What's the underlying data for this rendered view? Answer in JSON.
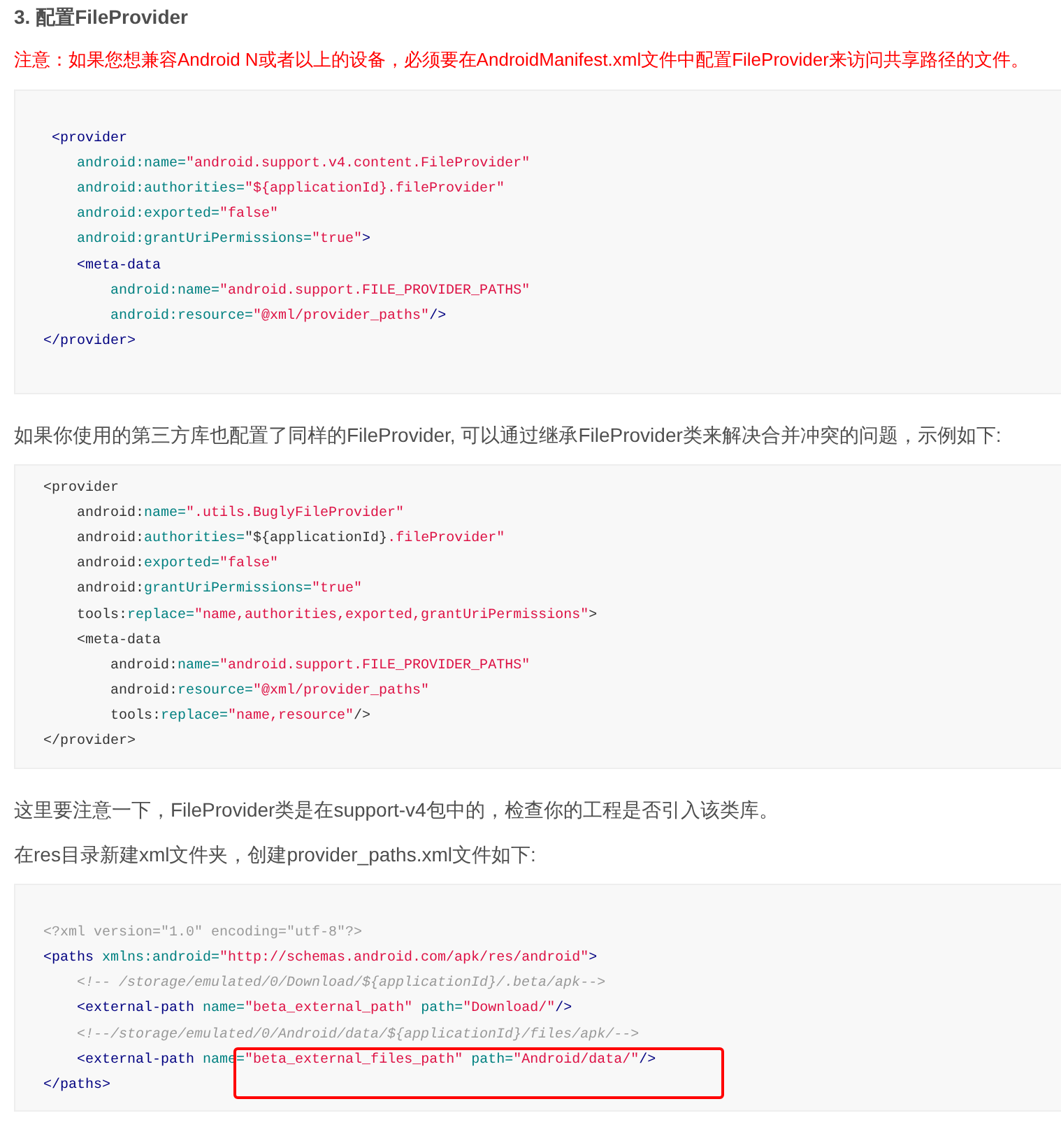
{
  "heading": "3. 配置FileProvider",
  "blocks": [
    {
      "kind": "note",
      "text": "注意：如果您想兼容Android N或者以上的设备，必须要在AndroidManifest.xml文件中配置FileProvider来访问共享路径的文件。"
    },
    {
      "kind": "code",
      "blank_before": true,
      "blank_after": true,
      "lines": [
        {
          "tokens": [
            {
              "kind": "tag",
              "text": " <provider"
            }
          ]
        },
        {
          "tokens": [
            {
              "kind": "attr",
              "text": "    android:name="
            },
            {
              "kind": "str",
              "text": "\"android.support.v4.content.FileProvider\""
            }
          ]
        },
        {
          "tokens": [
            {
              "kind": "attr",
              "text": "    android:authorities="
            },
            {
              "kind": "str",
              "text": "\"${applicationId}.fileProvider\""
            }
          ]
        },
        {
          "tokens": [
            {
              "kind": "attr",
              "text": "    android:exported="
            },
            {
              "kind": "str",
              "text": "\"false\""
            }
          ]
        },
        {
          "tokens": [
            {
              "kind": "attr",
              "text": "    android:grantUriPermissions="
            },
            {
              "kind": "str",
              "text": "\"true\""
            },
            {
              "kind": "tag",
              "text": ">"
            }
          ]
        },
        {
          "tokens": [
            {
              "kind": "tag",
              "text": "    <meta-data"
            }
          ]
        },
        {
          "tokens": [
            {
              "kind": "attr",
              "text": "        android:name="
            },
            {
              "kind": "str",
              "text": "\"android.support.FILE_PROVIDER_PATHS\""
            }
          ]
        },
        {
          "tokens": [
            {
              "kind": "attr",
              "text": "        android:resource="
            },
            {
              "kind": "str",
              "text": "\"@xml/provider_paths\""
            },
            {
              "kind": "tag",
              "text": "/>"
            }
          ]
        },
        {
          "tokens": [
            {
              "kind": "tag",
              "text": "</provider>"
            }
          ]
        }
      ]
    },
    {
      "kind": "para",
      "text": "如果你使用的第三方库也配置了同样的FileProvider, 可以通过继承FileProvider类来解决合并冲突的问题，示例如下:"
    },
    {
      "kind": "code",
      "blank_before": false,
      "blank_after": false,
      "lines": [
        {
          "tokens": [
            {
              "kind": "plain",
              "text": "<provider"
            }
          ]
        },
        {
          "tokens": [
            {
              "kind": "plain",
              "text": "    android:"
            },
            {
              "kind": "attr",
              "text": "name="
            },
            {
              "kind": "str",
              "text": "\".utils.BuglyFileProvider\""
            }
          ]
        },
        {
          "tokens": [
            {
              "kind": "plain",
              "text": "    android:"
            },
            {
              "kind": "attr",
              "text": "authorities="
            },
            {
              "kind": "plain",
              "text": "\"${applicationId}"
            },
            {
              "kind": "str",
              "text": ".fileProvider\""
            }
          ]
        },
        {
          "tokens": [
            {
              "kind": "plain",
              "text": "    android:"
            },
            {
              "kind": "attr",
              "text": "exported="
            },
            {
              "kind": "str",
              "text": "\"false\""
            }
          ]
        },
        {
          "tokens": [
            {
              "kind": "plain",
              "text": "    android:"
            },
            {
              "kind": "attr",
              "text": "grantUriPermissions="
            },
            {
              "kind": "str",
              "text": "\"true\""
            }
          ]
        },
        {
          "tokens": [
            {
              "kind": "plain",
              "text": "    tools:"
            },
            {
              "kind": "attr",
              "text": "replace="
            },
            {
              "kind": "str",
              "text": "\"name,authorities,exported,grantUriPermissions\""
            },
            {
              "kind": "plain",
              "text": ">"
            }
          ]
        },
        {
          "tokens": [
            {
              "kind": "plain",
              "text": "    <meta-data"
            }
          ]
        },
        {
          "tokens": [
            {
              "kind": "plain",
              "text": "        android:"
            },
            {
              "kind": "attr",
              "text": "name="
            },
            {
              "kind": "str",
              "text": "\"android.support.FILE_PROVIDER_PATHS\""
            }
          ]
        },
        {
          "tokens": [
            {
              "kind": "plain",
              "text": "        android:"
            },
            {
              "kind": "attr",
              "text": "resource="
            },
            {
              "kind": "str",
              "text": "\"@xml/provider_paths\""
            }
          ]
        },
        {
          "tokens": [
            {
              "kind": "plain",
              "text": "        tools:"
            },
            {
              "kind": "attr",
              "text": "replace="
            },
            {
              "kind": "str",
              "text": "\"name,resource\""
            },
            {
              "kind": "plain",
              "text": "/>"
            }
          ]
        },
        {
          "tokens": [
            {
              "kind": "plain",
              "text": "</provider>"
            }
          ]
        }
      ]
    },
    {
      "kind": "para",
      "text": "这里要注意一下，FileProvider类是在support-v4包中的，检查你的工程是否引入该类库。"
    },
    {
      "kind": "para",
      "text": "在res目录新建xml文件夹，创建provider_paths.xml文件如下:"
    },
    {
      "kind": "code",
      "blank_before": true,
      "blank_after": false,
      "lines": [
        {
          "tokens": [
            {
              "kind": "meta",
              "text": "<?xml version=\"1.0\" encoding=\"utf-8\"?>"
            }
          ]
        },
        {
          "tokens": [
            {
              "kind": "tag",
              "text": "<paths "
            },
            {
              "kind": "attr",
              "text": "xmlns:android="
            },
            {
              "kind": "str",
              "text": "\"http://schemas.android.com/apk/res/android\""
            },
            {
              "kind": "tag",
              "text": ">"
            }
          ]
        },
        {
          "tokens": [
            {
              "kind": "comment",
              "text": "    <!-- /storage/emulated/0/Download/${applicationId}/.beta/apk-->"
            }
          ]
        },
        {
          "tokens": [
            {
              "kind": "tag",
              "text": "    <external-path "
            },
            {
              "kind": "attr",
              "text": "name="
            },
            {
              "kind": "str",
              "text": "\"beta_external_path\""
            },
            {
              "kind": "attr",
              "text": " path="
            },
            {
              "kind": "str",
              "text": "\"Download/\""
            },
            {
              "kind": "tag",
              "text": "/>"
            }
          ]
        },
        {
          "tokens": [
            {
              "kind": "comment",
              "text": "    <!--/storage/emulated/0/Android/data/${applicationId}/files/apk/-->"
            }
          ]
        },
        {
          "boxed": true,
          "tokens": [
            {
              "kind": "tag",
              "text": "    <external-path "
            },
            {
              "kind": "attr",
              "text": "name="
            },
            {
              "kind": "str",
              "text": "\"beta_external_files_path\""
            },
            {
              "kind": "attr",
              "text": " path="
            },
            {
              "kind": "str",
              "text": "\"Android/data/\""
            },
            {
              "kind": "tag",
              "text": "/>"
            }
          ]
        },
        {
          "tokens": [
            {
              "kind": "tag",
              "text": "</paths>"
            }
          ]
        }
      ]
    }
  ]
}
